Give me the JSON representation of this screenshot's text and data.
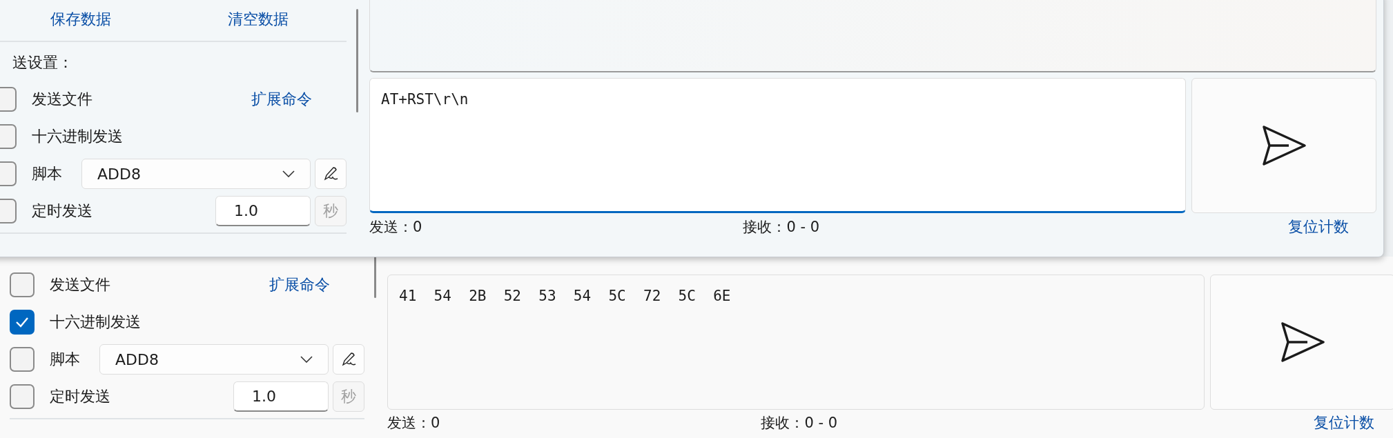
{
  "front_window": {
    "actions": [
      {
        "label": "保存数据"
      },
      {
        "label": "清空数据"
      }
    ],
    "send_settings_label": "送设置：",
    "options": [
      {
        "kind": "file",
        "label": "发送文件",
        "checked": false,
        "link": "扩展命令"
      },
      {
        "kind": "hex",
        "label": "十六进制发送",
        "checked": false
      },
      {
        "kind": "script",
        "label": "脚本",
        "checked": false,
        "value": "ADD8"
      },
      {
        "kind": "timer",
        "label": "定时发送",
        "checked": false,
        "value": "1.0",
        "unit": "秒",
        "unit_disabled": true
      }
    ],
    "input": {
      "value": "AT+RST\\r\\n",
      "focused": true
    },
    "status": {
      "sent": "发送：0",
      "received": "接收：0 - 0",
      "reset": "复位计数"
    }
  },
  "back_window": {
    "options": [
      {
        "kind": "file",
        "label": "发送文件",
        "checked": false,
        "link": "扩展命令"
      },
      {
        "kind": "hex",
        "label": "十六进制发送",
        "checked": true
      },
      {
        "kind": "script",
        "label": "脚本",
        "checked": false,
        "value": "ADD8"
      },
      {
        "kind": "timer",
        "label": "定时发送",
        "checked": false,
        "value": "1.0",
        "unit": "秒",
        "unit_disabled": true
      }
    ],
    "input": {
      "value": "41  54  2B  52  53  54  5C  72  5C  6E",
      "focused": false
    },
    "status": {
      "sent": "发送：0",
      "received": "接收：0 - 0",
      "reset": "复位计数"
    }
  }
}
